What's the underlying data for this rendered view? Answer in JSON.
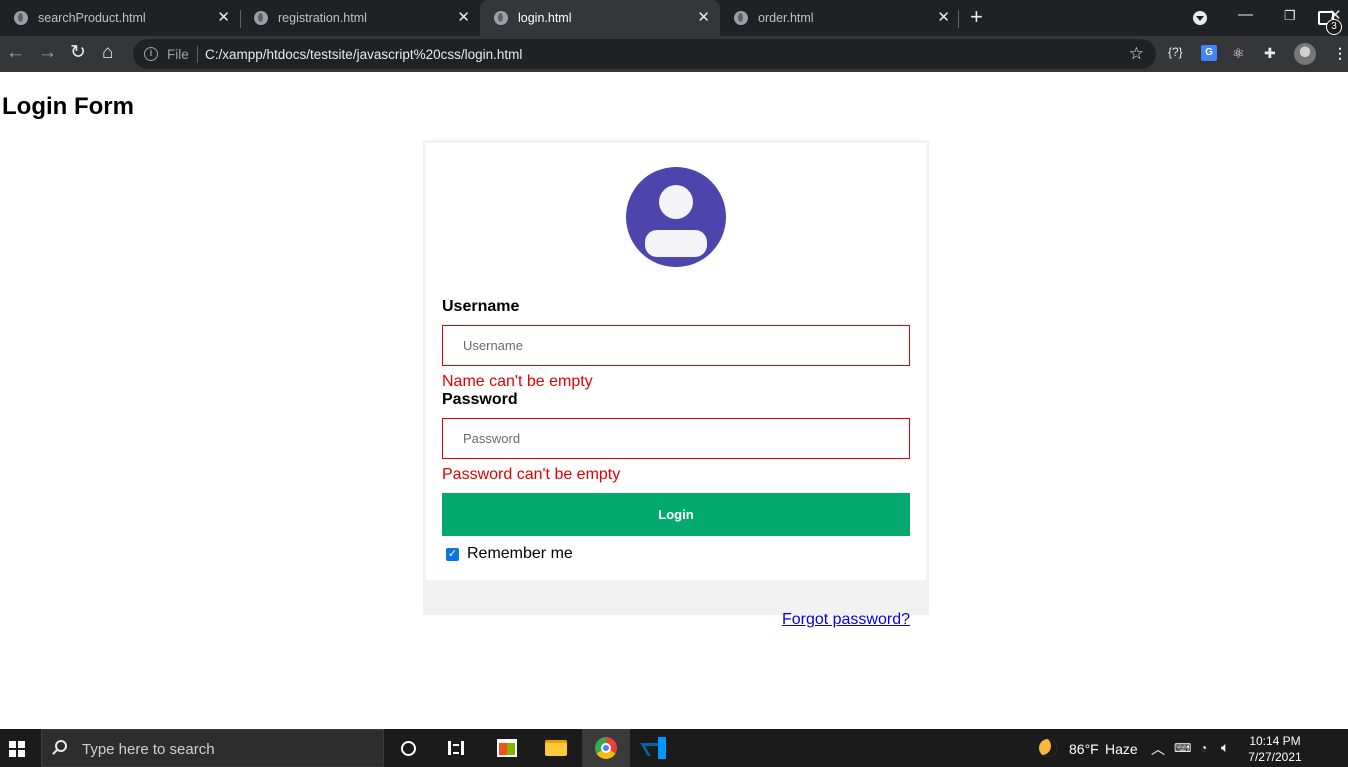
{
  "browser": {
    "tabs": [
      {
        "label": "searchProduct.html",
        "active": false
      },
      {
        "label": "registration.html",
        "active": false
      },
      {
        "label": "login.html",
        "active": true
      },
      {
        "label": "order.html",
        "active": false
      }
    ],
    "new_tab_icon": "plus-icon",
    "file_label": "File",
    "url": "C:/xampp/htdocs/testsite/javascript%20css/login.html"
  },
  "page": {
    "title": "Login Form",
    "avatar_icon": "user-avatar-icon",
    "avatar_color": "#4d45ac",
    "username": {
      "label": "Username",
      "placeholder": "Username",
      "value": "",
      "error": "Name can't be empty"
    },
    "password": {
      "label": "Password",
      "placeholder": "Password",
      "value": "",
      "error": "Password can't be empty"
    },
    "login_button": "Login",
    "login_button_color": "#04aa6d",
    "remember_me": {
      "label": "Remember me",
      "checked": true
    },
    "forgot_password": "Forgot password?",
    "error_color": "#e00000"
  },
  "taskbar": {
    "search_placeholder": "Type here to search",
    "weather": {
      "temp": "86°F",
      "condition": "Haze"
    },
    "clock": {
      "time": "10:14 PM",
      "date": "7/27/2021"
    },
    "notification_count": "3"
  }
}
